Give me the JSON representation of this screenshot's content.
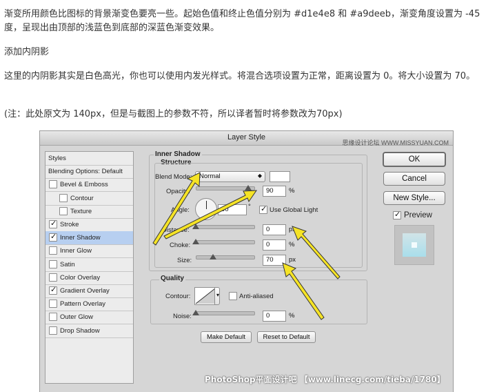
{
  "article": {
    "p1": "渐变所用颜色比图标的背景渐变色要亮一些。起始色值和终止色值分别为 #d1e4e8 和 #a9deeb，渐变角度设置为 -45 度，呈现出由顶部的浅蓝色到底部的深蓝色渐变效果。",
    "p2": "添加内阴影",
    "p3": "这里的内阴影其实是白色高光，你也可以使用内发光样式。将混合选项设置为正常，距离设置为 0。将大小设置为 70。",
    "p4": "(注：此处原文为 140px，但是与截图上的参数不符，所以译者暂时将参数改为70px)"
  },
  "dialog": {
    "title": "Layer Style",
    "watermark_top": "思缘设计论坛 WWW.MISSYUAN.COM",
    "styles_list": [
      {
        "label": "Styles",
        "checkbox": false,
        "checked": false,
        "indent": 0,
        "selected": false
      },
      {
        "label": "Blending Options: Default",
        "checkbox": false,
        "checked": false,
        "indent": 0,
        "selected": false
      },
      {
        "label": "Bevel & Emboss",
        "checkbox": true,
        "checked": false,
        "indent": 0,
        "selected": false
      },
      {
        "label": "Contour",
        "checkbox": true,
        "checked": false,
        "indent": 1,
        "selected": false
      },
      {
        "label": "Texture",
        "checkbox": true,
        "checked": false,
        "indent": 1,
        "selected": false
      },
      {
        "label": "Stroke",
        "checkbox": true,
        "checked": true,
        "indent": 0,
        "selected": false
      },
      {
        "label": "Inner Shadow",
        "checkbox": true,
        "checked": true,
        "indent": 0,
        "selected": true
      },
      {
        "label": "Inner Glow",
        "checkbox": true,
        "checked": false,
        "indent": 0,
        "selected": false
      },
      {
        "label": "Satin",
        "checkbox": true,
        "checked": false,
        "indent": 0,
        "selected": false
      },
      {
        "label": "Color Overlay",
        "checkbox": true,
        "checked": false,
        "indent": 0,
        "selected": false
      },
      {
        "label": "Gradient Overlay",
        "checkbox": true,
        "checked": true,
        "indent": 0,
        "selected": false
      },
      {
        "label": "Pattern Overlay",
        "checkbox": true,
        "checked": false,
        "indent": 0,
        "selected": false
      },
      {
        "label": "Outer Glow",
        "checkbox": true,
        "checked": false,
        "indent": 0,
        "selected": false
      },
      {
        "label": "Drop Shadow",
        "checkbox": true,
        "checked": false,
        "indent": 0,
        "selected": false
      }
    ],
    "inner_shadow": {
      "section_title": "Inner Shadow",
      "structure_title": "Structure",
      "blend_mode_label": "Blend Mode:",
      "blend_mode_value": "Normal",
      "shadow_color": "#ffffff",
      "opacity_label": "Opacity:",
      "opacity_value": "90",
      "opacity_level": 0.9,
      "percent": "%",
      "angle_label": "Angle:",
      "angle_value": "90",
      "degree": "°",
      "use_global_light_label": "Use Global Light",
      "use_global_light_checked": true,
      "check_mark": "✓",
      "distance_label": "Distance:",
      "distance_value": "0",
      "distance_level": 0,
      "px": "px",
      "choke_label": "Choke:",
      "choke_value": "0",
      "choke_level": 0,
      "size_label": "Size:",
      "size_value": "70",
      "size_level": 0.3
    },
    "quality": {
      "title": "Quality",
      "contour_label": "Contour:",
      "anti_aliased_label": "Anti-aliased",
      "anti_aliased_checked": false,
      "noise_label": "Noise:",
      "noise_value": "0",
      "noise_level": 0,
      "percent": "%"
    },
    "make_default_label": "Make Default",
    "reset_default_label": "Reset to Default",
    "ok_label": "OK",
    "cancel_label": "Cancel",
    "new_style_label": "New Style...",
    "preview_label": "Preview",
    "preview_checked": true,
    "preview_gradient_start": "#d1e4e8",
    "preview_gradient_end": "#a9deeb"
  },
  "watermark_bottom": "PhotoShop平面设计吧 【www.linecg.com/tieba/1780】",
  "annotation_color": "#f5e326"
}
